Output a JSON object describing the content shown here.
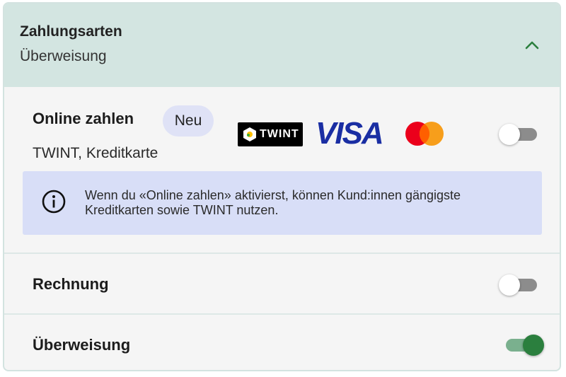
{
  "header": {
    "title": "Zahlungsarten",
    "subtitle": "Überweisung",
    "chevron_icon": "chevron-up-icon",
    "accent_color": "#2b7f3e"
  },
  "online": {
    "label": "Online zahlen",
    "badge": "Neu",
    "subtitle": "TWINT, Kreditkarte",
    "logos": {
      "twint": "TWINT",
      "visa": "VISA",
      "mastercard": "mastercard-logo"
    },
    "toggle_on": false,
    "info_icon": "info-icon",
    "info_text": "Wenn du «Online zahlen» aktivierst, können Kund:innen gängigste Kreditkarten sowie TWINT nutzen."
  },
  "rechnung": {
    "label": "Rechnung",
    "toggle_on": false
  },
  "ueberweisung": {
    "label": "Überweisung",
    "toggle_on": true
  }
}
